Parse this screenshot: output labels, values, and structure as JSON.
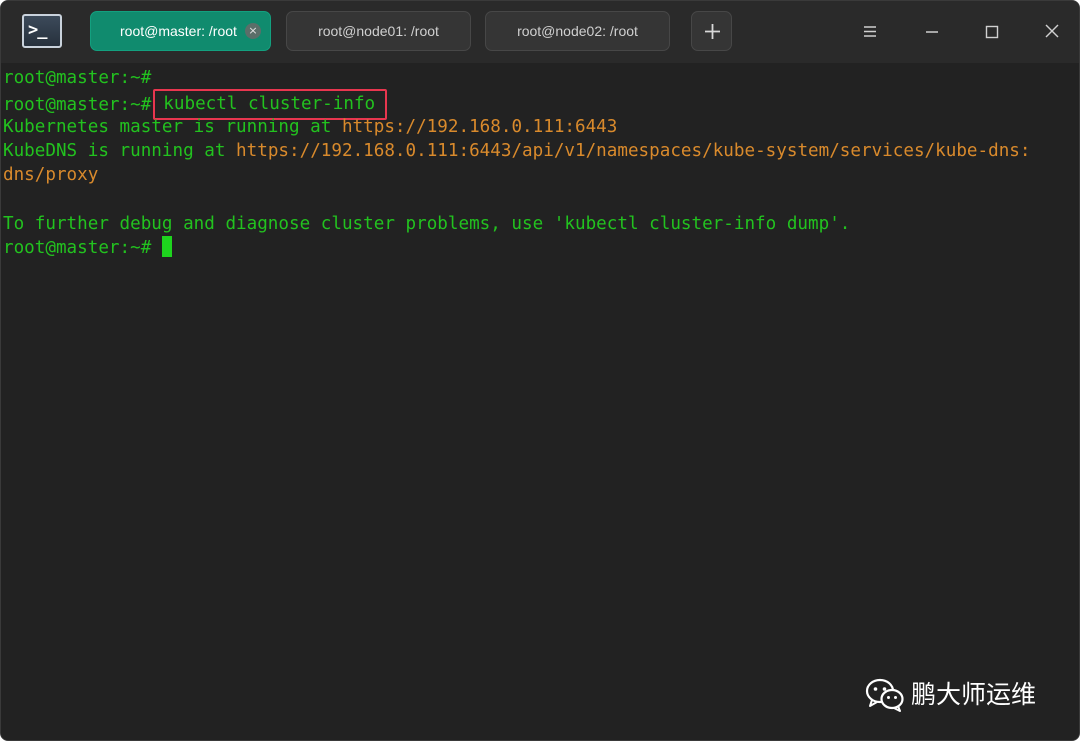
{
  "window": {
    "app_icon": "terminal-icon",
    "tabs": [
      {
        "label": "root@master: /root",
        "active": true,
        "close_glyph": "×"
      },
      {
        "label": "root@node01: /root",
        "active": false
      },
      {
        "label": "root@node02: /root",
        "active": false
      }
    ],
    "add_tab_icon": "plus-icon",
    "controls": [
      "menu-icon",
      "minimize-icon",
      "maximize-icon",
      "close-icon"
    ]
  },
  "terminal": {
    "prompt": "root@master:~#",
    "command": "kubectl cluster-info",
    "output": {
      "line1_text": "Kubernetes master is running at ",
      "line1_url": "https://192.168.0.111:6443",
      "line2_text": "KubeDNS is running at ",
      "line2_url_part1": "https://192.168.0.111:6443/api/v1/namespaces/kube-system/services/kube-dns:",
      "line2_url_part2": "dns/proxy",
      "hint": "To further debug and diagnose cluster problems, use 'kubectl cluster-info dump'."
    },
    "colors": {
      "text": "#22c21f",
      "url": "#d98a2c",
      "highlight_box": "#e8364f",
      "active_tab": "#108b6e"
    }
  },
  "watermark": {
    "icon": "wechat-icon",
    "text": "鹏大师运维"
  }
}
